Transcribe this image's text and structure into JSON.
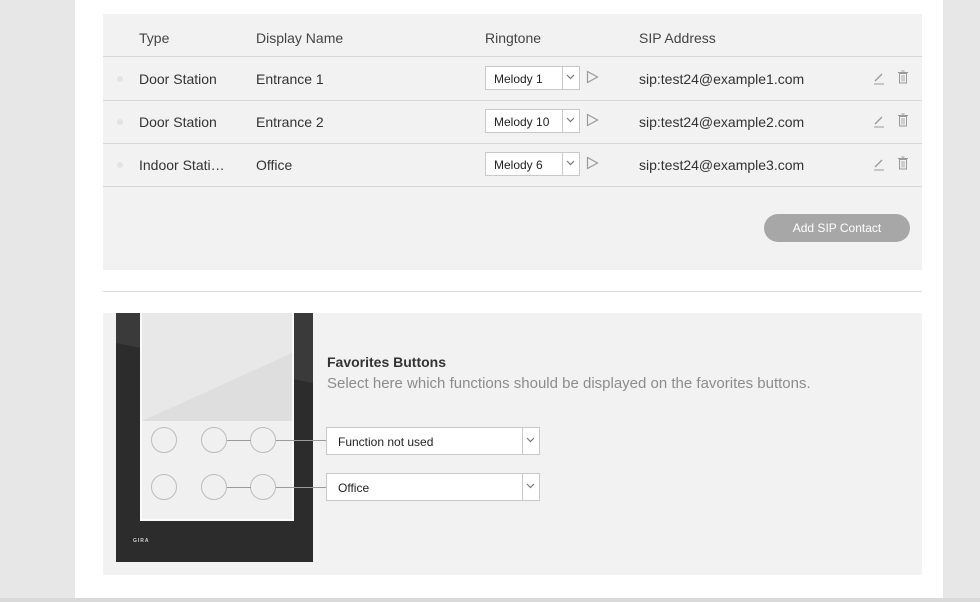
{
  "contacts_table": {
    "headers": {
      "type": "Type",
      "display_name": "Display Name",
      "ringtone": "Ringtone",
      "sip_address": "SIP Address"
    },
    "rows": [
      {
        "type": "Door Station",
        "display_name": "Entrance 1",
        "ringtone": "Melody 1",
        "sip_address": "sip:test24@example1.com"
      },
      {
        "type": "Door Station",
        "display_name": "Entrance 2",
        "ringtone": "Melody 10",
        "sip_address": "sip:test24@example2.com"
      },
      {
        "type": "Indoor Stati…",
        "display_name": "Office",
        "ringtone": "Melody 6",
        "sip_address": "sip:test24@example3.com"
      }
    ],
    "row_icons": [
      "play-icon",
      "pencil-icon",
      "trash-icon"
    ],
    "add_button_label": "Add SIP Contact"
  },
  "favorites": {
    "title": "Favorites Buttons",
    "subtitle": "Select here which functions should be displayed on the favorites buttons.",
    "selects": [
      {
        "value": "Function not used"
      },
      {
        "value": "Office"
      }
    ],
    "device_brand": "GIRA"
  },
  "colors": {
    "background": "#e6e6e6",
    "card": "#f2f2f2",
    "button": "#a7a7a7",
    "device": "#2c2c2c"
  }
}
